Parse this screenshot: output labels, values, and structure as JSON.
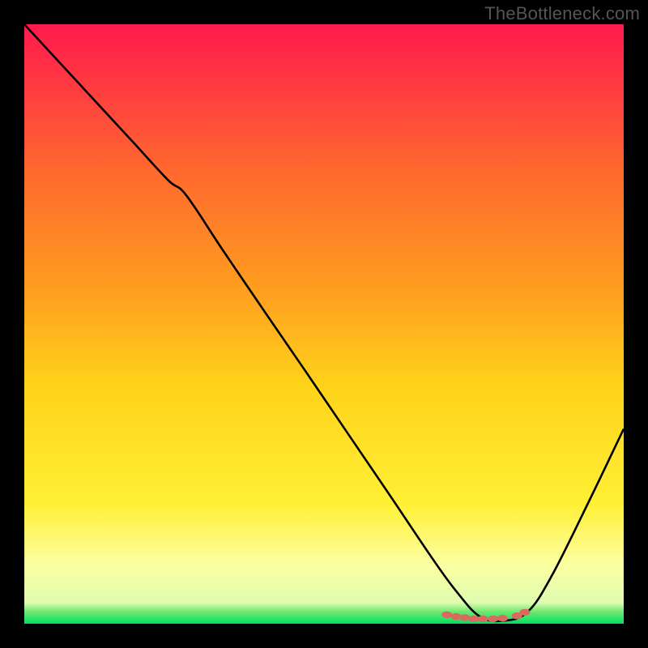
{
  "watermark": "TheBottleneck.com",
  "colors": {
    "background": "#000000",
    "curve": "#000000",
    "markers": "#d96a5f",
    "gradient_stops": [
      {
        "offset": 0.0,
        "color": "#ff1a4d"
      },
      {
        "offset": 0.25,
        "color": "#ff6a2e"
      },
      {
        "offset": 0.45,
        "color": "#ffa01f"
      },
      {
        "offset": 0.6,
        "color": "#ffd21a"
      },
      {
        "offset": 0.8,
        "color": "#fff035"
      },
      {
        "offset": 0.9,
        "color": "#fcffa0"
      },
      {
        "offset": 0.965,
        "color": "#dffcb0"
      },
      {
        "offset": 0.98,
        "color": "#6ee86e"
      },
      {
        "offset": 1.0,
        "color": "#00e060"
      }
    ]
  },
  "chart_data": {
    "type": "line",
    "title": "",
    "xlabel": "",
    "ylabel": "",
    "xlim": [
      0,
      1
    ],
    "ylim": [
      0,
      1
    ],
    "grid": false,
    "legend_position": "none",
    "notes": "Single-curve bottleneck profile. x is normalized configuration position (0→1, left→right). y is normalized bottleneck magnitude (0 = no bottleneck / green band, 1 = maximum / red). Values estimated from pixels; gentle inflection near x≈0.25 corresponding to slope change.",
    "series": [
      {
        "name": "bottleneck_curve",
        "x": [
          0.0,
          0.06,
          0.12,
          0.18,
          0.24,
          0.27,
          0.33,
          0.4,
          0.47,
          0.54,
          0.61,
          0.68,
          0.72,
          0.76,
          0.8,
          0.84,
          0.88,
          0.94,
          1.0
        ],
        "y": [
          1.0,
          0.935,
          0.87,
          0.805,
          0.74,
          0.715,
          0.625,
          0.522,
          0.42,
          0.317,
          0.214,
          0.11,
          0.055,
          0.012,
          0.005,
          0.02,
          0.08,
          0.2,
          0.325
        ]
      }
    ],
    "markers": {
      "name": "selected_range",
      "color": "#d96a5f",
      "points": [
        {
          "x": 0.705,
          "y": 0.015
        },
        {
          "x": 0.72,
          "y": 0.012
        },
        {
          "x": 0.735,
          "y": 0.01
        },
        {
          "x": 0.75,
          "y": 0.008
        },
        {
          "x": 0.765,
          "y": 0.008
        },
        {
          "x": 0.782,
          "y": 0.008
        },
        {
          "x": 0.798,
          "y": 0.009
        },
        {
          "x": 0.822,
          "y": 0.013
        },
        {
          "x": 0.835,
          "y": 0.019
        }
      ]
    }
  }
}
